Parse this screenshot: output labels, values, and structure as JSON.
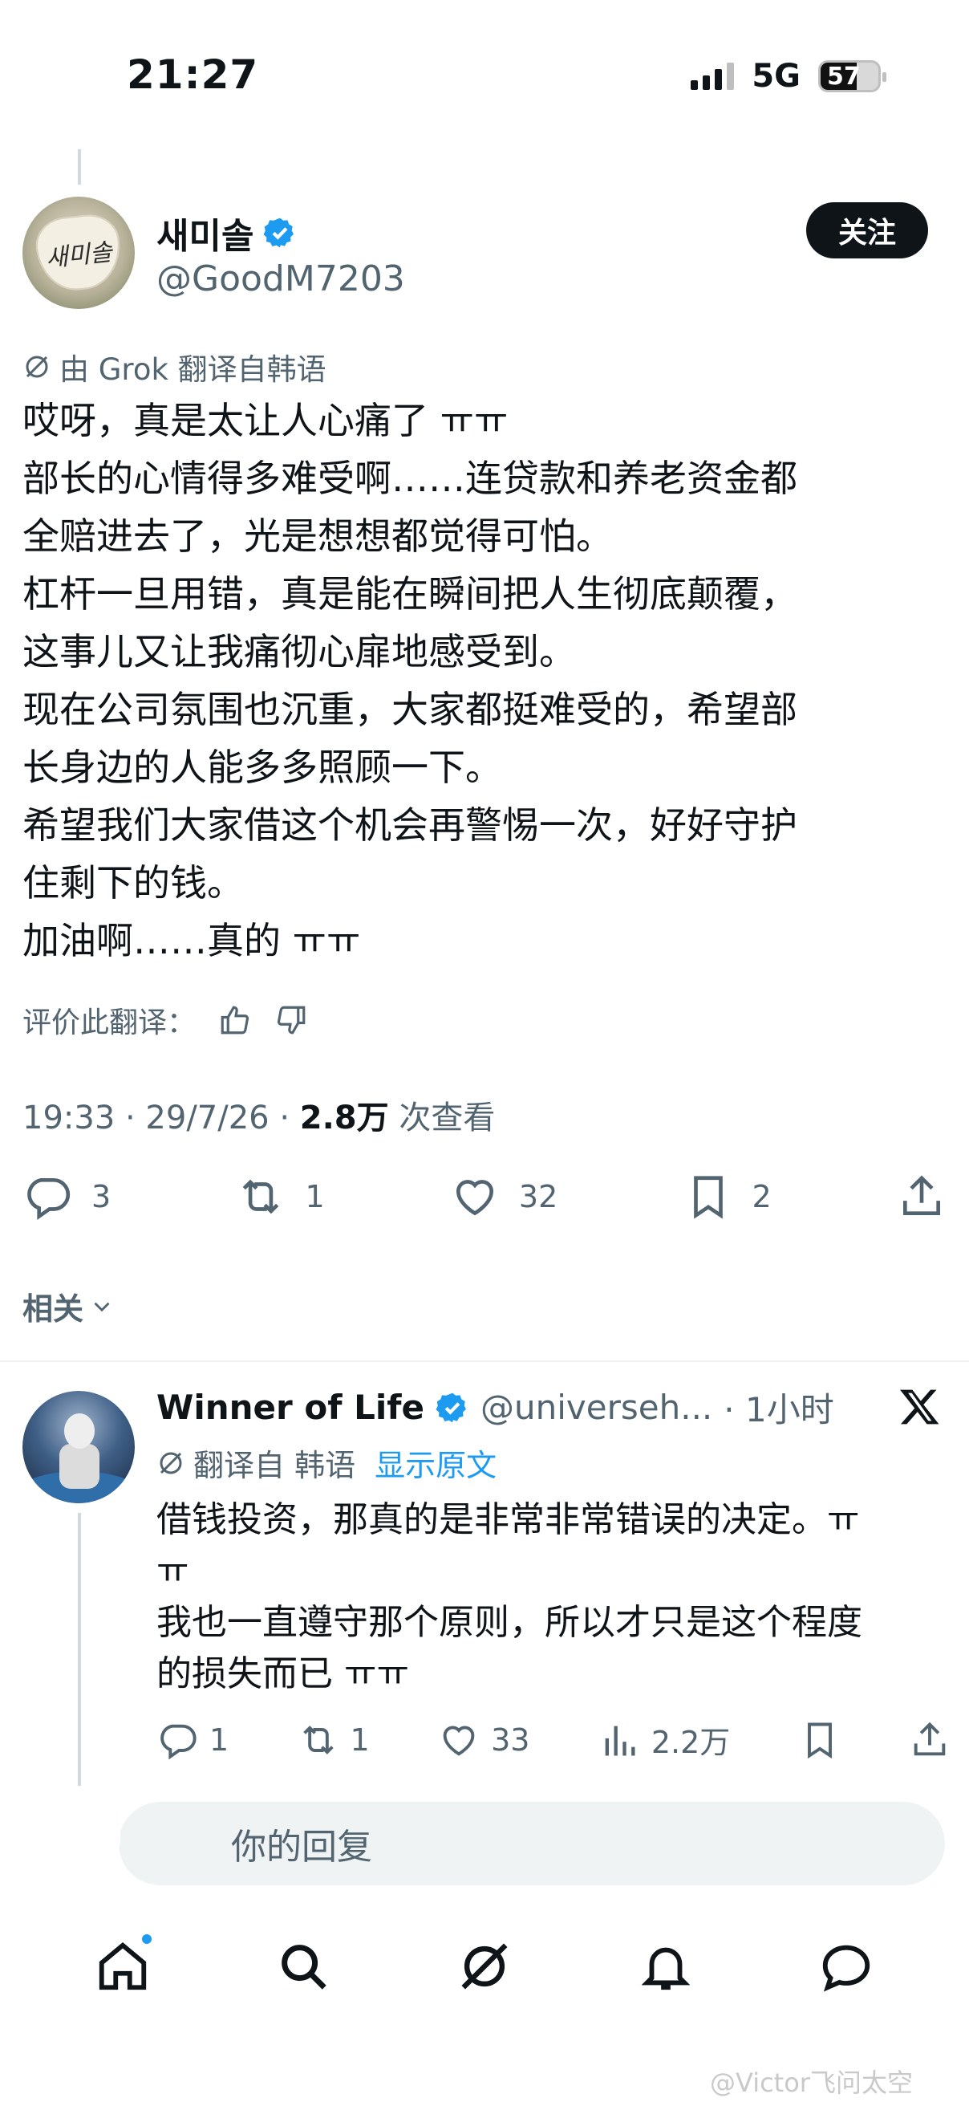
{
  "status_bar": {
    "time": "21:27",
    "network": "5G",
    "battery": "57"
  },
  "tweet": {
    "author_name": "새미솔",
    "author_handle": "@GoodM7203",
    "avatar_text": "새미솔",
    "follow_label": "关注",
    "translated_by": "由 Grok 翻译自韩语",
    "lines": [
      "哎呀，真是太让人心痛了 ㅠㅠ",
      "部长的心情得多难受啊……连贷款和养老资金都",
      "全赔进去了，光是想想都觉得可怕。",
      "杠杆一旦用错，真是能在瞬间把人生彻底颠覆，",
      "这事儿又让我痛彻心扉地感受到。",
      "现在公司氛围也沉重，大家都挺难受的，希望部",
      "长身边的人能多多照顾一下。",
      "希望我们大家借这个机会再警惕一次，好好守护",
      "住剩下的钱。",
      "加油啊……真的 ㅠㅠ"
    ],
    "rate_label": "评价此翻译：",
    "timestamp": "19:33 · 29/7/26 · ",
    "views_count": "2.8万",
    "views_label": " 次查看",
    "stats": {
      "replies": "3",
      "retweets": "1",
      "likes": "32",
      "bookmarks": "2"
    }
  },
  "related_label": "相关",
  "reply": {
    "name": "Winner of Life",
    "handle": "@universeh...",
    "time": "· 1小时",
    "translated_from": "翻译自 韩语",
    "show_original": "显示原文",
    "lines": [
      "借钱投资，那真的是非常非常错误的决定。ㅠ",
      "ㅠ",
      "我也一直遵守那个原则，所以才只是这个程度",
      "的损失而已 ㅠㅠ"
    ],
    "stats": {
      "replies": "1",
      "retweets": "1",
      "likes": "33",
      "views": "2.2万"
    }
  },
  "compose": {
    "placeholder": "你的回复"
  },
  "watermark": "@Victor飞问太空",
  "colors": {
    "accent": "#1d9bf0",
    "text": "#0f1419",
    "muted": "#536471"
  },
  "icons": [
    "grok-icon",
    "verified-badge-icon",
    "thumbs-up-icon",
    "thumbs-down-icon",
    "reply-icon",
    "retweet-icon",
    "like-icon",
    "bookmark-icon",
    "share-icon",
    "views-icon",
    "x-logo-icon",
    "home-icon",
    "search-icon",
    "grok-nav-icon",
    "notifications-icon",
    "messages-icon"
  ]
}
